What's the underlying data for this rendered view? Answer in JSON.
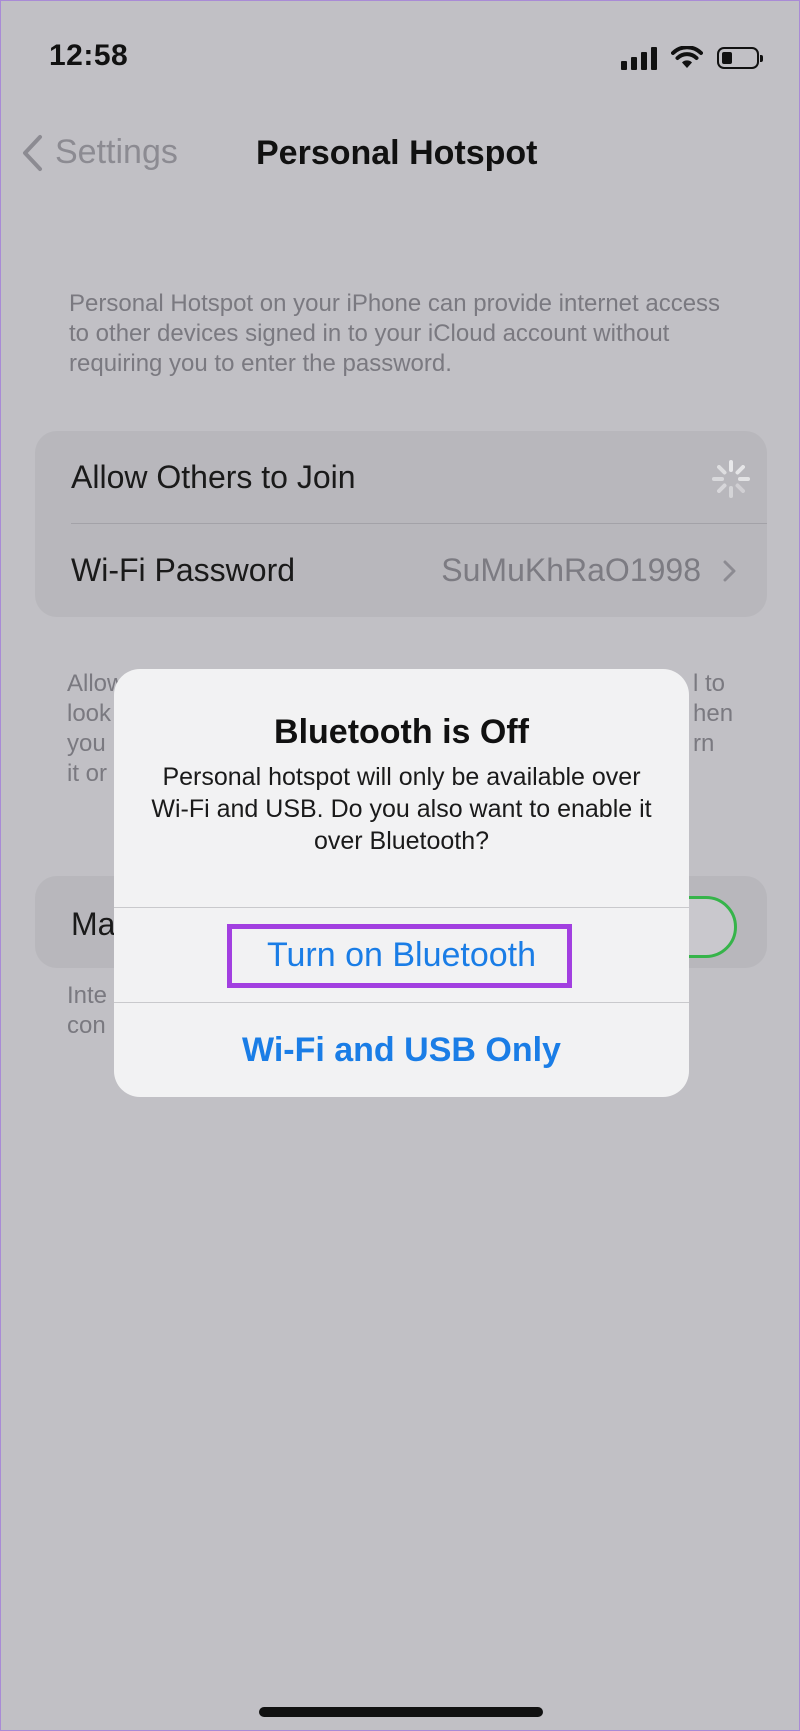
{
  "status_bar": {
    "time": "12:58",
    "icons": [
      "signal-icon",
      "wifi-icon",
      "battery-icon"
    ]
  },
  "nav": {
    "back_label": "Settings",
    "title": "Personal Hotspot"
  },
  "description": "Personal Hotspot on your iPhone can provide internet access to other devices signed in to your iCloud account without requiring you to enter the password.",
  "settings_group": {
    "rows": [
      {
        "label": "Allow Others to Join",
        "accessory": "spinner-icon"
      },
      {
        "label": "Wi-Fi Password",
        "value": "SuMuKhRaO1998",
        "accessory": "chevron-right-icon"
      }
    ]
  },
  "background_partial": {
    "text_lines": [
      "Allow",
      "look",
      "you",
      "it or"
    ],
    "text_lines_right": [
      "l to",
      "hen",
      "rn"
    ],
    "row_label": "Ma",
    "footer_lines": [
      "Inte",
      "con"
    ]
  },
  "alert": {
    "title": "Bluetooth is Off",
    "message": "Personal hotspot will only be available over Wi-Fi and USB. Do you also want to enable it over Bluetooth?",
    "buttons": {
      "primary": "Turn on Bluetooth",
      "secondary": "Wi-Fi and USB Only"
    },
    "highlight_color": "#a23fe0"
  },
  "colors": {
    "accent_blue": "#1a7de6",
    "toggle_green": "#36b44a"
  }
}
